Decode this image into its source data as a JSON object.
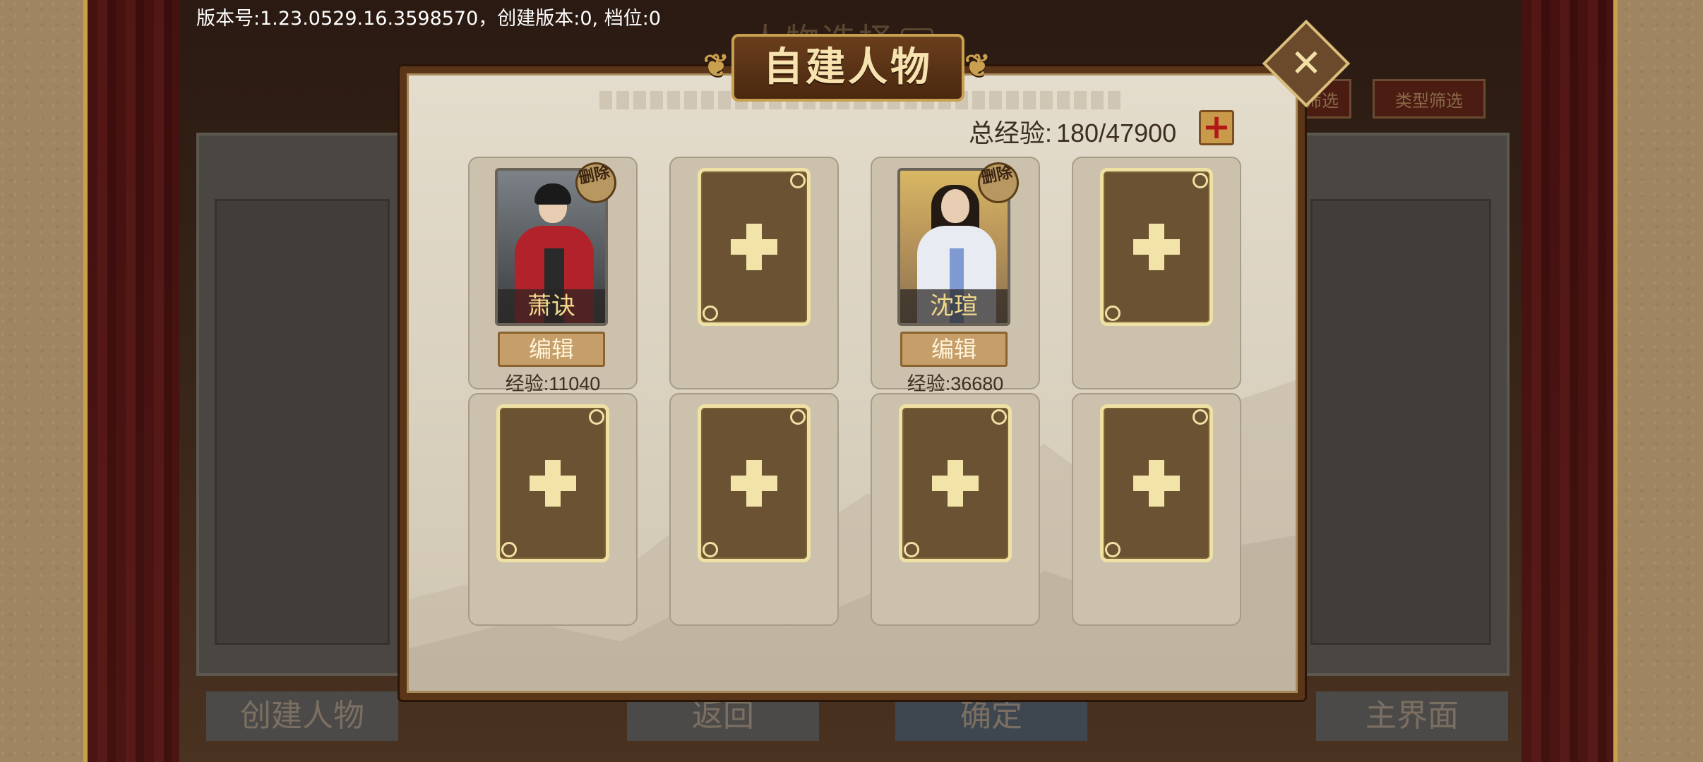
{
  "version_text": "版本号:1.23.0529.16.3598570，创建版本:0, 档位:0",
  "background": {
    "title": "人物选择",
    "filters": [
      "筛选",
      "类型筛选"
    ],
    "buttons": [
      "创建人物",
      "返回",
      "确定",
      "主界面"
    ]
  },
  "dialog": {
    "title": "自建人物",
    "close_icon": "close-x",
    "total_exp_label": "总经验:",
    "total_exp_value": "180/47900",
    "add_exp_icon": "plus",
    "slots": [
      {
        "filled": true,
        "name": "萧诀",
        "delete_label": "删除",
        "edit_label": "编辑",
        "exp_text": "经验:11040",
        "portrait": "warrior-red"
      },
      {
        "filled": false
      },
      {
        "filled": true,
        "name": "沈瑄",
        "delete_label": "删除",
        "edit_label": "编辑",
        "exp_text": "经验:36680",
        "portrait": "scholar-white"
      },
      {
        "filled": false
      },
      {
        "filled": false
      },
      {
        "filled": false
      },
      {
        "filled": false
      },
      {
        "filled": false
      }
    ]
  },
  "colors": {
    "accent_gold": "#efe0a4",
    "card_brown": "#6b5232",
    "dialog_border": "#5a3518",
    "add_red": "#b31818"
  }
}
